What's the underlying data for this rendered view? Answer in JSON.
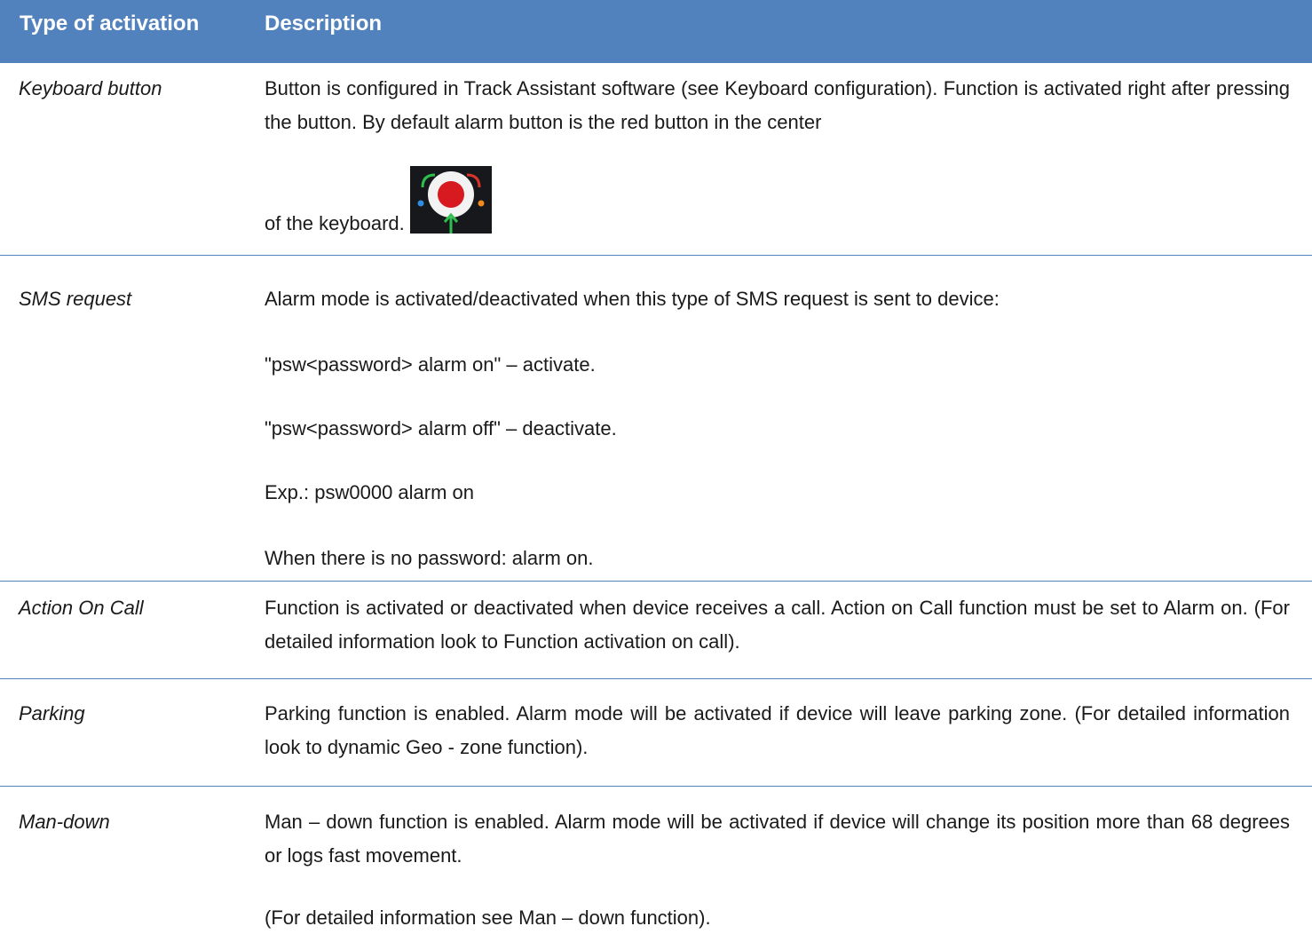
{
  "header": {
    "col1": "Type of activation",
    "col2": "Description"
  },
  "colors": {
    "header_bg": "#5182be",
    "rule": "#5182be",
    "text": "#1a1a1a"
  },
  "rows": [
    {
      "type": "Keyboard button",
      "lines": [
        "Button is configured in Track Assistant software (see Keyboard configuration). Function is activated right after pressing the button. By default alarm button is the red button in the center",
        "of the keyboard."
      ],
      "icon": "alarm-keyboard-button-icon"
    },
    {
      "type": "SMS request",
      "lines": [
        "Alarm mode is activated/deactivated when this type of SMS request is sent to device:",
        "\"psw<password> alarm on\" – activate.",
        "\"psw<password> alarm off\" – deactivate.",
        "Exp.: psw0000 alarm on",
        "When there is no password: alarm on."
      ]
    },
    {
      "type": "Action On Call",
      "lines": [
        "Function is activated or deactivated when device receives a call. Action on Call function must be set to Alarm on. (For detailed information look to Function activation on call)."
      ]
    },
    {
      "type": "Parking",
      "lines": [
        "Parking function is enabled. Alarm mode will be activated if device will leave parking zone. (For detailed information look to dynamic Geo - zone function)."
      ]
    },
    {
      "type": "Man-down",
      "lines": [
        "Man – down function is enabled. Alarm mode will be activated if device will change its position more than 68 degrees or logs fast movement.",
        "(For detailed information see Man – down function)."
      ]
    }
  ]
}
